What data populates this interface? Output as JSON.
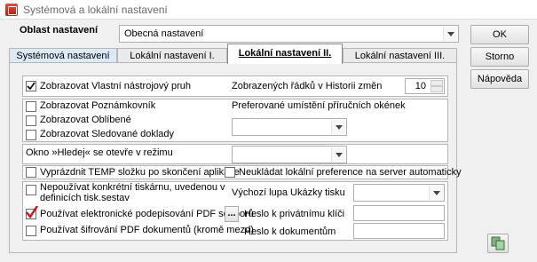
{
  "window": {
    "title": "Systémová a lokální nastavení"
  },
  "area": {
    "label": "Oblast nastavení",
    "selected": "Obecná nastavení"
  },
  "tabs": [
    {
      "label": "Systémová nastavení"
    },
    {
      "label": "Lokální nastavení I."
    },
    {
      "label": "Lokální nastavení II."
    },
    {
      "label": "Lokální nastavení III."
    }
  ],
  "buttons": {
    "ok": "OK",
    "cancel": "Storno",
    "help": "Nápověda",
    "browse": "..."
  },
  "group1": {
    "toolbar": {
      "label": "Zobrazovat Vlastní nástrojový pruh",
      "checked": true
    },
    "history": {
      "label": "Zobrazených řádků v Historii změn",
      "value": "10"
    }
  },
  "group2": {
    "notebook": {
      "label": "Zobrazovat Poznámkovník",
      "checked": false
    },
    "favorites": {
      "label": "Zobrazovat Oblíbené",
      "checked": false
    },
    "tracked": {
      "label": "Zobrazovat Sledované doklady",
      "checked": false
    },
    "windows_pos_label": "Preferované umístění příručních okének",
    "windows_pos_value": ""
  },
  "group3": {
    "search_mode_label": "Okno »Hledej« se otevře v režimu",
    "search_mode_value": ""
  },
  "group4": {
    "empty_temp": {
      "label": "Vyprázdnit TEMP složku po skončení aplikace",
      "checked": false
    },
    "no_save_local": {
      "label": "Neukládat lokální preference na server automaticky",
      "checked": false
    }
  },
  "group5": {
    "no_printer": {
      "label_line1": "Nepoužívat konkrétní tiskárnu, uvedenou v",
      "label_line2": "definicích tisk.sestav",
      "checked": false
    },
    "zoom_label": "Výchozí lupa Ukázky tisku",
    "zoom_value": "",
    "pdf_sign": {
      "label": "Používat elektronické podepisování PDF souborů",
      "checked": true
    },
    "pdf_encrypt": {
      "label": "Používat šifrování PDF dokumentů (kromě mezd)",
      "checked": false
    },
    "key_password_label": "Heslo k privátnímu klíči",
    "key_password_value": "",
    "doc_password_label": "Heslo k dokumentům",
    "doc_password_value": ""
  },
  "icons": {
    "app": "app-icon",
    "check": "checkmark-icon",
    "arrow": "chevron-down-icon",
    "copy": "copy-settings-icon"
  },
  "colors": {
    "check_red": "#d01010",
    "tab_blue": "#dce9f7"
  }
}
